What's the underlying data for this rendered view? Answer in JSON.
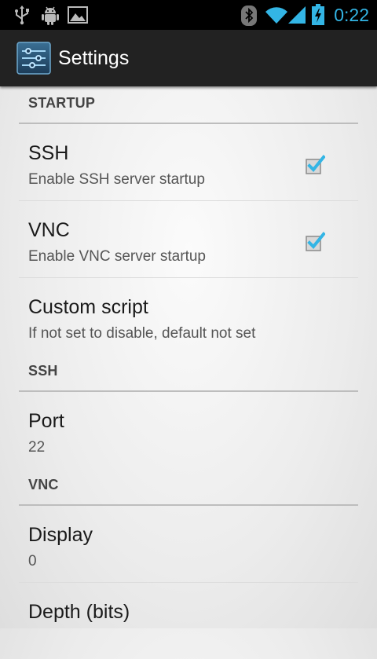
{
  "status_bar": {
    "time": "0:22",
    "icons": [
      "usb-icon",
      "android-debug-icon",
      "image-notification-icon",
      "bluetooth-icon",
      "wifi-icon",
      "signal-icon",
      "battery-charging-icon"
    ],
    "accent_color": "#33b5e5"
  },
  "action_bar": {
    "title": "Settings",
    "icon": "settings-sliders-icon"
  },
  "sections": {
    "startup": {
      "header": "STARTUP",
      "ssh": {
        "title": "SSH",
        "summary": "Enable SSH server startup",
        "checked": true
      },
      "vnc": {
        "title": "VNC",
        "summary": "Enable VNC server startup",
        "checked": true
      },
      "custom_script": {
        "title": "Custom script",
        "summary": "If not set to disable, default not set"
      }
    },
    "ssh": {
      "header": "SSH",
      "port": {
        "title": "Port",
        "summary": "22"
      }
    },
    "vnc": {
      "header": "VNC",
      "display": {
        "title": "Display",
        "summary": "0"
      },
      "depth": {
        "title": "Depth (bits)"
      }
    }
  }
}
